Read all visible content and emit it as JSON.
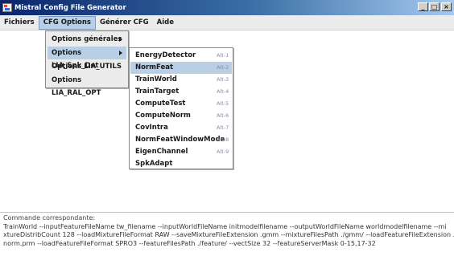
{
  "window": {
    "title": "Mistral Config File Generator",
    "buttons": {
      "minimize": "_",
      "maximize": "□",
      "close": "×"
    }
  },
  "menubar": {
    "items": [
      "Fichiers",
      "CFG Options",
      "Générer CFG",
      "Aide"
    ],
    "active": "CFG Options"
  },
  "cfg_menu": {
    "items": [
      {
        "label": "Options générales",
        "has_submenu": true
      },
      {
        "label": "Options LIA_Spk_Det",
        "has_submenu": true,
        "highlighted": true
      },
      {
        "label": "Options LIA_UTILS",
        "has_submenu": false
      },
      {
        "label": "Options LIA_RAL_OPT",
        "has_submenu": false
      }
    ]
  },
  "spk_det_submenu": {
    "items": [
      {
        "label": "EnergyDetector",
        "shortcut": "Alt-1"
      },
      {
        "label": "NormFeat",
        "shortcut": "Alt-2",
        "highlighted": true
      },
      {
        "label": "TrainWorld",
        "shortcut": "Alt-3"
      },
      {
        "label": "TrainTarget",
        "shortcut": "Alt-4"
      },
      {
        "label": "ComputeTest",
        "shortcut": "Alt-5"
      },
      {
        "label": "ComputeNorm",
        "shortcut": "Alt-6"
      },
      {
        "label": "CovIntra",
        "shortcut": "Alt-7"
      },
      {
        "label": "NormFeatWindowMode",
        "shortcut": "Alt-8"
      },
      {
        "label": "EigenChannel",
        "shortcut": "Alt-9"
      },
      {
        "label": "SpkAdapt",
        "shortcut": ""
      }
    ]
  },
  "command": {
    "label": "Commande correspondante:",
    "lines": [
      " TrainWorld --inputFeatureFileName tw_filename --inputWorldFileName initmodelfilename --outputWorldFileName worldmodelfilename --mi",
      "xtureDistribCount 128 --loadMixtureFileFormat RAW --saveMixtureFileExtension .gmm --mixtureFilesPath ./gmm/ --loadFeatureFileExtension .",
      "norm.prm --loadFeatureFileFormat SPRO3 --featureFilesPath ./feature/ --vectSize 32 --featureServerMask 0-15,17-32"
    ]
  }
}
